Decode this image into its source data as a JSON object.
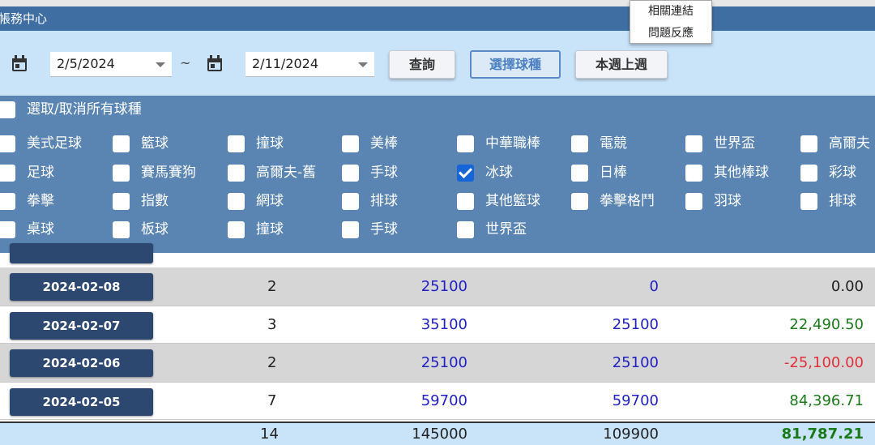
{
  "app": {
    "title": "帳務中心"
  },
  "menu": {
    "items": [
      "相關連結",
      "問題反應"
    ]
  },
  "filter": {
    "start_date": "2/5/2024",
    "separator": "~",
    "end_date": "2/11/2024",
    "buttons": {
      "query": "查詢",
      "select_sport": "選擇球種",
      "week": "本週上週"
    }
  },
  "sports": {
    "select_all_label": "選取/取消所有球種",
    "items": [
      {
        "label": "美式足球",
        "checked": false
      },
      {
        "label": "籃球",
        "checked": false
      },
      {
        "label": "撞球",
        "checked": false
      },
      {
        "label": "美棒",
        "checked": false
      },
      {
        "label": "中華職棒",
        "checked": false
      },
      {
        "label": "電競",
        "checked": false
      },
      {
        "label": "世界盃",
        "checked": false
      },
      {
        "label": "高爾夫",
        "checked": false
      },
      {
        "label": "足球",
        "checked": false
      },
      {
        "label": "賽馬賽狗",
        "checked": false
      },
      {
        "label": "高爾夫-舊",
        "checked": false
      },
      {
        "label": "手球",
        "checked": false
      },
      {
        "label": "冰球",
        "checked": true
      },
      {
        "label": "日棒",
        "checked": false
      },
      {
        "label": "其他棒球",
        "checked": false
      },
      {
        "label": "彩球",
        "checked": false
      },
      {
        "label": "拳擊",
        "checked": false
      },
      {
        "label": "指數",
        "checked": false
      },
      {
        "label": "網球",
        "checked": false
      },
      {
        "label": "排球",
        "checked": false
      },
      {
        "label": "其他籃球",
        "checked": false
      },
      {
        "label": "拳擊格鬥",
        "checked": false
      },
      {
        "label": "羽球",
        "checked": false
      },
      {
        "label": "排球",
        "checked": false
      },
      {
        "label": "桌球",
        "checked": false
      },
      {
        "label": "板球",
        "checked": false
      },
      {
        "label": "撞球",
        "checked": false
      },
      {
        "label": "手球",
        "checked": false
      },
      {
        "label": "世界盃",
        "checked": false
      }
    ]
  },
  "table": {
    "rows": [
      {
        "date": "2024-02-08",
        "count": "2",
        "amount": "25100",
        "valid": "0",
        "result": "0.00",
        "result_status": "neutral"
      },
      {
        "date": "2024-02-07",
        "count": "3",
        "amount": "35100",
        "valid": "25100",
        "result": "22,490.50",
        "result_status": "positive"
      },
      {
        "date": "2024-02-06",
        "count": "2",
        "amount": "25100",
        "valid": "25100",
        "result": "-25,100.00",
        "result_status": "negative"
      },
      {
        "date": "2024-02-05",
        "count": "7",
        "amount": "59700",
        "valid": "59700",
        "result": "84,396.71",
        "result_status": "positive"
      }
    ],
    "total": {
      "count": "14",
      "amount": "145000",
      "valid": "109900",
      "result": "81,787.21"
    }
  },
  "colors": {
    "title_bar": "#3f6ea2",
    "filter_bg": "#c9e3f9",
    "sports_bg": "#5a85b3",
    "date_button": "#2c4870",
    "positive": "#1a7a1a",
    "negative": "#e0303a",
    "amount": "#2121c4"
  }
}
